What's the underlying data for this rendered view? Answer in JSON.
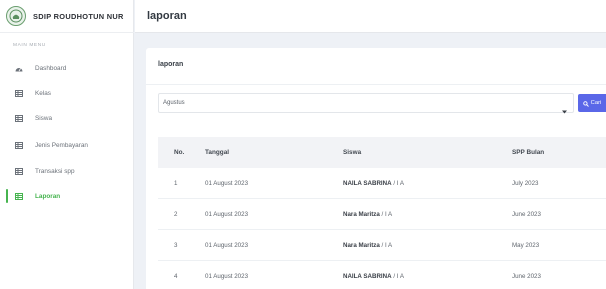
{
  "brand": {
    "name": "SDIP ROUDHOTUN NUR"
  },
  "sidebar": {
    "section_label": "MAIN MENU",
    "items": [
      {
        "label": "Dashboard",
        "icon": "dashboard-icon",
        "active": false
      },
      {
        "label": "Kelas",
        "icon": "table-icon",
        "active": false
      },
      {
        "label": "Siswa",
        "icon": "table-icon",
        "active": false
      },
      {
        "label": "Jenis Pembayaran",
        "icon": "table-icon",
        "active": false
      },
      {
        "label": "Transaksi spp",
        "icon": "table-icon",
        "active": false
      },
      {
        "label": "Laporan",
        "icon": "table-icon",
        "active": true
      }
    ]
  },
  "header": {
    "title": "laporan"
  },
  "card": {
    "title": "laporan",
    "filter": {
      "selected_month": "Agustus",
      "search_label": "Cari",
      "search_icon": "search-icon"
    }
  },
  "table": {
    "columns": [
      "No.",
      "Tanggal",
      "Siswa",
      "SPP Bulan"
    ],
    "rows": [
      {
        "no": "1",
        "tanggal": "01 August 2023",
        "siswa_name": "NAILA SABRINA",
        "siswa_class": " / I A",
        "spp_bulan": "July 2023"
      },
      {
        "no": "2",
        "tanggal": "01 August 2023",
        "siswa_name": "Nara Maritza",
        "siswa_class": " / I A",
        "spp_bulan": "June 2023"
      },
      {
        "no": "3",
        "tanggal": "01 August 2023",
        "siswa_name": "Nara Maritza",
        "siswa_class": " / I A",
        "spp_bulan": "May 2023"
      },
      {
        "no": "4",
        "tanggal": "01 August 2023",
        "siswa_name": "NAILA SABRINA",
        "siswa_class": " / I A",
        "spp_bulan": "June 2023"
      }
    ]
  },
  "colors": {
    "accent_green": "#46b44f",
    "button_blue": "#5a67e8",
    "background": "#eef1f6"
  }
}
